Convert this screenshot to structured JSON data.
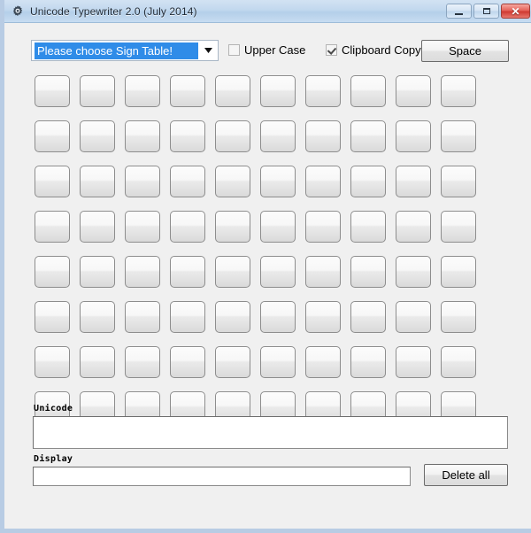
{
  "window": {
    "title": "Unicode Typewriter 2.0 (July 2014)",
    "app_icon": "gear-sprocket-icon",
    "controls": {
      "minimize": "minimize-icon",
      "maximize": "maximize-icon",
      "close": "✕"
    },
    "frame_color": "#b8cce4",
    "titlebar_color": "#c2d8ee",
    "client_background": "#f0f0f0"
  },
  "toolbar": {
    "sign_table": {
      "selected": "Please choose Sign Table!",
      "highlight_color": "#2f8ce8",
      "arrow_icon": "chevron-down-icon"
    },
    "upper_case": {
      "label": "Upper Case",
      "checked": false
    },
    "clipboard_copy": {
      "label": "Clipboard Copy",
      "checked": true
    },
    "space_button": {
      "label": "Space"
    }
  },
  "keypad": {
    "rows": 8,
    "columns": 10,
    "count": 80,
    "keys": [
      "",
      "",
      "",
      "",
      "",
      "",
      "",
      "",
      "",
      "",
      "",
      "",
      "",
      "",
      "",
      "",
      "",
      "",
      "",
      "",
      "",
      "",
      "",
      "",
      "",
      "",
      "",
      "",
      "",
      "",
      "",
      "",
      "",
      "",
      "",
      "",
      "",
      "",
      "",
      "",
      "",
      "",
      "",
      "",
      "",
      "",
      "",
      "",
      "",
      "",
      "",
      "",
      "",
      "",
      "",
      "",
      "",
      "",
      "",
      "",
      "",
      "",
      "",
      "",
      "",
      "",
      "",
      "",
      "",
      "",
      "",
      "",
      "",
      "",
      "",
      "",
      "",
      "",
      "",
      ""
    ]
  },
  "output": {
    "unicode_label": "Unicode",
    "unicode_value": "",
    "display_label": "Display",
    "display_value": "",
    "delete_all_button": "Delete all"
  }
}
